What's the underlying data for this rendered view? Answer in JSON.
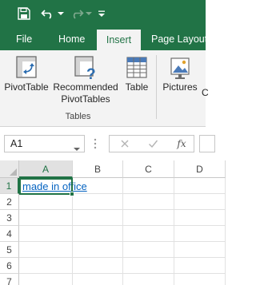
{
  "quick_access": {
    "icons": [
      "save-icon",
      "undo-icon",
      "redo-icon",
      "customize-icon"
    ]
  },
  "tabs": [
    {
      "label": "File"
    },
    {
      "label": "Home"
    },
    {
      "label": "Insert",
      "active": true
    },
    {
      "label": "Page Layout"
    }
  ],
  "ribbon": {
    "pivottable": "PivotTable",
    "recommended_line1": "Recommended",
    "recommended_line2": "PivotTables",
    "table": "Table",
    "pictures": "Pictures",
    "partial_next": "C",
    "group_tables": "Tables"
  },
  "formula_bar": {
    "name_box": "A1",
    "fx_label": "fx",
    "formula": ""
  },
  "grid": {
    "columns": [
      "A",
      "B",
      "C",
      "D"
    ],
    "rows": [
      "1",
      "2",
      "3",
      "4",
      "5",
      "6",
      "7"
    ],
    "selected_column": "A",
    "selected_row": "1",
    "cell_a1": "made in office"
  },
  "colors": {
    "accent": "#217346",
    "hyperlink": "#0563c1"
  }
}
